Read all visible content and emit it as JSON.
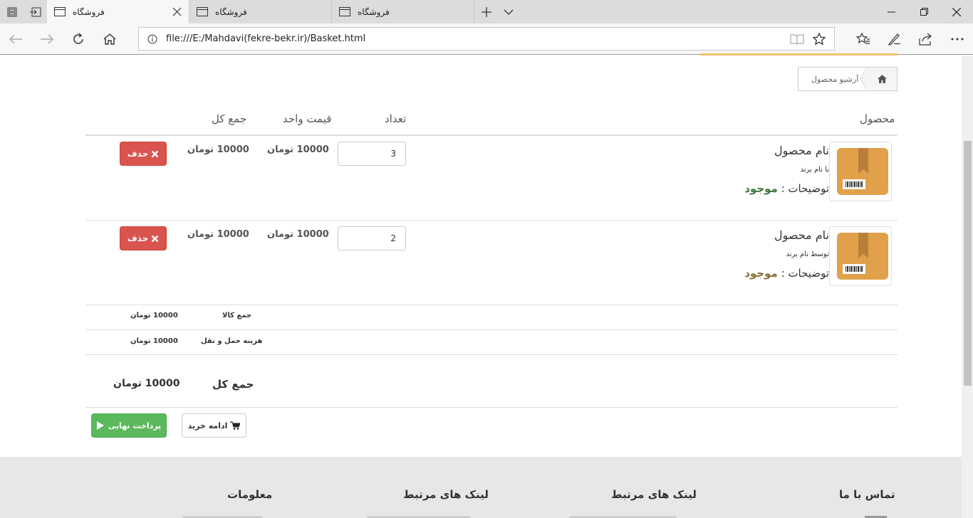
{
  "browser": {
    "tabs": [
      {
        "title": "فروشگاه",
        "active": true
      },
      {
        "title": "فروشگاه",
        "active": false
      },
      {
        "title": "فروشگاه",
        "active": false
      }
    ],
    "address": "file:///E:/Mahdavi(fekre-bekr.ir)/Basket.html"
  },
  "breadcrumb": {
    "current": "آرشیو محصول"
  },
  "table_header": {
    "product": "محصول",
    "quantity": "تعداد",
    "unit_price": "قیمت واحد",
    "total": "جمع کل"
  },
  "items": [
    {
      "name": "نام محصول",
      "brand": "با نام برند",
      "desc_label": "توضیحات :",
      "status": "موجود",
      "quantity": "3",
      "unit_price": "10000 تومان",
      "total": "10000 تومان",
      "delete_label": "حذف"
    },
    {
      "name": "نام محصول",
      "brand": "توسط نام برند",
      "desc_label": "توضیحات :",
      "status": "موجود",
      "quantity": "2",
      "unit_price": "10000 تومان",
      "total": "10000 تومان",
      "delete_label": "حذف"
    }
  ],
  "summary": {
    "goods_label": "جمع کالا",
    "goods_value": "10000 تومان",
    "shipping_label": "هزینه حمل و نقل",
    "shipping_value": "10000 تومان",
    "total_label": "جمع کل",
    "total_value": "10000 تومان"
  },
  "actions": {
    "continue_label": "ادامه خرید",
    "pay_label": "پرداخت نهایی"
  },
  "footer": {
    "contact_title": "تماس با ما",
    "links1_title": "لینک های مرتبط",
    "links2_title": "لینک های مرتبط",
    "info_title": "معلومات"
  },
  "colors": {
    "accent_green": "#5cb85c",
    "danger_red": "#d9534f",
    "status_green": "#3c763d",
    "box_orange": "#e0a14a"
  }
}
